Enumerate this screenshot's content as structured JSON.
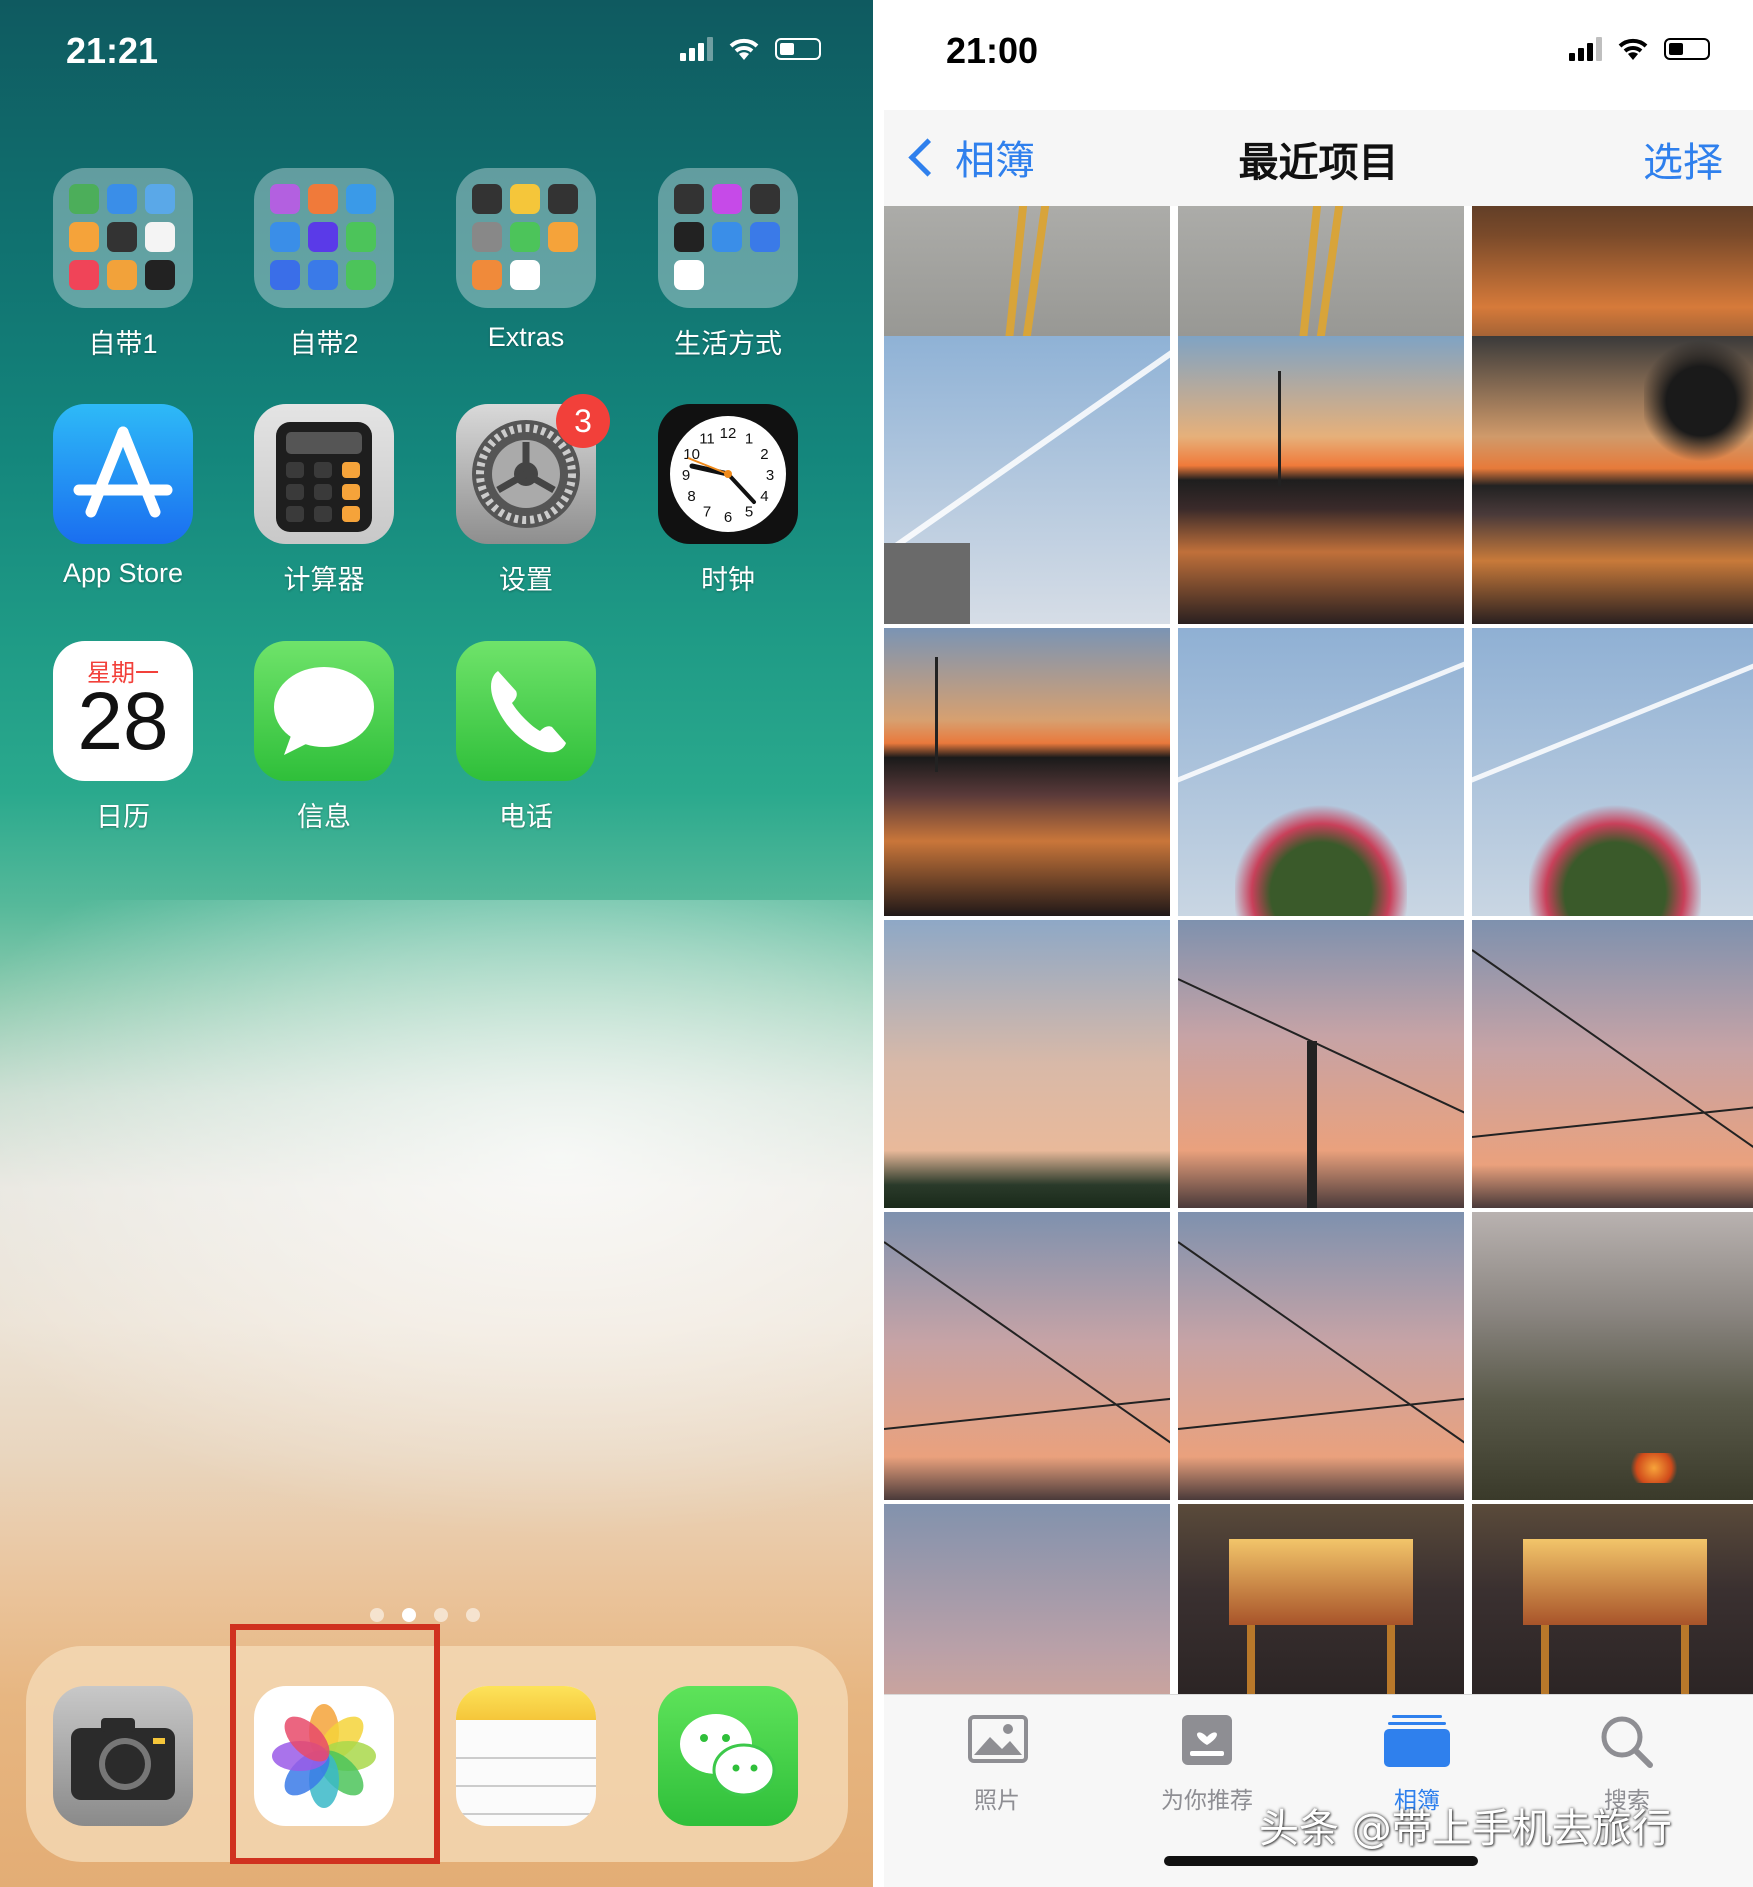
{
  "home": {
    "time": "21:21",
    "rows": [
      [
        {
          "label": "自带1",
          "kind": "folder",
          "mini": [
            "#4cae5a",
            "#3a8ee8",
            "#5aa8e8",
            "#f5a33a",
            "#333333",
            "#f4f4f4",
            "#f04458",
            "#f2a23a",
            "#222222"
          ]
        },
        {
          "label": "自带2",
          "kind": "folder",
          "mini": [
            "#b360e0",
            "#f07a3a",
            "#3a9ae8",
            "#3a8ee8",
            "#5a3ae8",
            "#4cc45a",
            "#3a6ee8",
            "#3a7ae8",
            "#4cc45a"
          ]
        },
        {
          "label": "Extras",
          "kind": "folder",
          "mini": [
            "#333333",
            "#f5c63a",
            "#333333",
            "#888888",
            "#4cc45a",
            "#f5a33a",
            "#f08a3a",
            "#ffffff"
          ]
        },
        {
          "label": "生活方式",
          "kind": "folder",
          "mini": [
            "#333333",
            "#c64ae8",
            "#333333",
            "#222222",
            "#3a8ee8",
            "#3a7ae8",
            "#ffffff"
          ]
        }
      ],
      [
        {
          "label": "App Store",
          "kind": "appstore"
        },
        {
          "label": "计算器",
          "kind": "calculator"
        },
        {
          "label": "设置",
          "kind": "settings",
          "badge": "3"
        },
        {
          "label": "时钟",
          "kind": "clock",
          "numbers": [
            "12",
            "1",
            "2",
            "3",
            "4",
            "5",
            "6",
            "7",
            "8",
            "9",
            "10",
            "11"
          ]
        }
      ],
      [
        {
          "label": "日历",
          "kind": "calendar",
          "weekday": "星期一",
          "day": "28"
        },
        {
          "label": "信息",
          "kind": "messages"
        },
        {
          "label": "电话",
          "kind": "phone"
        }
      ]
    ],
    "pages": {
      "count": 4,
      "current": 1
    },
    "dock": [
      {
        "name": "camera",
        "kind": "camera"
      },
      {
        "name": "photos",
        "kind": "photos"
      },
      {
        "name": "notes",
        "kind": "notes"
      },
      {
        "name": "wechat",
        "kind": "wechat"
      }
    ]
  },
  "photos": {
    "time": "21:00",
    "back_label": "相簿",
    "title": "最近项目",
    "select_label": "选择",
    "grid": [
      [
        "road",
        "road",
        "sunset-dark"
      ],
      [
        "sky-contrail",
        "sunset-tower",
        "sunset-tree"
      ],
      [
        "sunset-left",
        "sky-flowers",
        "sky-flowers"
      ],
      [
        "sky-cloud",
        "sky-wires-crane",
        "sky-wires"
      ],
      [
        "sky-wires",
        "sky-wires",
        "smoke-fire"
      ],
      [
        "sky-evening",
        "gate-night",
        "gate-night"
      ]
    ],
    "tabs": [
      {
        "label": "照片",
        "icon": "photos-tab-icon"
      },
      {
        "label": "为你推荐",
        "icon": "for-you-tab-icon"
      },
      {
        "label": "相簿",
        "icon": "albums-tab-icon",
        "active": true
      },
      {
        "label": "搜索",
        "icon": "search-tab-icon"
      }
    ],
    "watermark": "头条 @带上手机去旅行"
  },
  "colors": {
    "accent": "#2f80ed",
    "badge": "#f2403a",
    "highlight": "#d0311f"
  }
}
